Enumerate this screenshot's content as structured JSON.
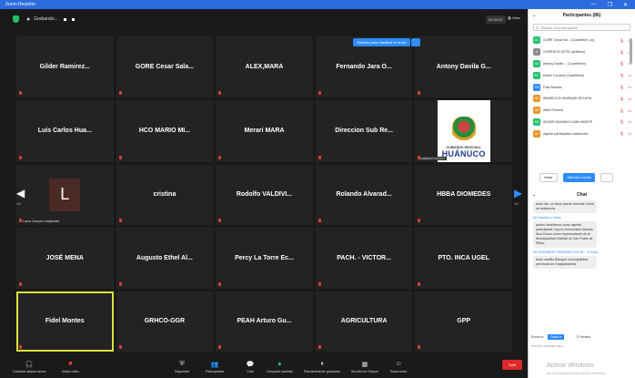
{
  "window": {
    "title": "Zoom Reunión",
    "min": "—",
    "max": "❐",
    "close": "✕"
  },
  "topbar": {
    "status": "Grabando...",
    "time": "02:31:57",
    "view": "Vista"
  },
  "hint": {
    "text": "Solicitar para reactivar el audio",
    "more": "…"
  },
  "tiles": [
    {
      "name": "Gilder Ramirez..."
    },
    {
      "name": "GORE Cesar Sala..."
    },
    {
      "name": "ALEX,MARA"
    },
    {
      "name": "Fernando Jara O..."
    },
    {
      "name": "Antony Davila G..."
    },
    {
      "name": "Luis Carlos Hua..."
    },
    {
      "name": "HCO MARIO MI..."
    },
    {
      "name": "Merari MARA"
    },
    {
      "name": "Direccion Sub Re..."
    },
    {
      "name": "",
      "logo": true
    },
    {
      "name": "",
      "letter": "L",
      "caption": "Laura Campos malpartida"
    },
    {
      "name": "cristina"
    },
    {
      "name": "Rodolfo VALDIVI..."
    },
    {
      "name": "Rolando Alvarad..."
    },
    {
      "name": "HBBA DIOMEDES"
    },
    {
      "name": "JOSÉ MENA"
    },
    {
      "name": "Augusto Ethel Al..."
    },
    {
      "name": "Percy La Torre Ec..."
    },
    {
      "name": "PACH. - VICTOR..."
    },
    {
      "name": "PTO. INCA UGEL"
    },
    {
      "name": "Fidel Montes",
      "active": true
    },
    {
      "name": "GRHCO-GGR"
    },
    {
      "name": "PEAH Arturo Gu..."
    },
    {
      "name": "AGRICULTURA"
    },
    {
      "name": "GPP"
    }
  ],
  "logo": {
    "small": "GOBIERNO REGIONAL",
    "big": "HUÁNUCO",
    "caption": "GOREHCO-SG/EDA"
  },
  "nav": {
    "left_page": "1/4",
    "right_page": "1/4"
  },
  "toolbar": {
    "audio": "Conectar altavoz ahora",
    "video": "Iniciar video",
    "security": "Seguridad",
    "participants": "Participantes",
    "participants_count": "86",
    "chat": "Chat",
    "share": "Compartir pantalla",
    "record": "Pausar/detener grabación",
    "breakout": "Sección en Grupos",
    "reactions": "Reacciones",
    "end": "Salir"
  },
  "panel": {
    "title": "Participantes (86)",
    "search_placeholder": "Buscar un participante",
    "participants": [
      {
        "initials": "GC",
        "color": "#23c16b",
        "name": "GORE Cesar Sa... (Coanfitrión, yo)"
      },
      {
        "initials": "G",
        "color": "#8a8a8a",
        "name": "GOREHCO-SGTD (Anfitrión)"
      },
      {
        "initials": "AD",
        "color": "#23c16b",
        "name": "Antony Davila ... (Coanfitrión)"
      },
      {
        "initials": "EC",
        "color": "#23c16b",
        "name": "Edwin Cordova (Coanfitrión)"
      },
      {
        "initials": "FM",
        "color": "#2d8cff",
        "name": "Fidel Montes"
      },
      {
        "initials": "AD",
        "color": "#e8962a",
        "name": "ABIMELECH DURAND SEGURA"
      },
      {
        "initials": "AR",
        "color": "#e8962a",
        "name": "Adler Romero"
      },
      {
        "initials": "AD",
        "color": "#23c16b",
        "name": "ADNER DAMIAN LUJAN INDEPE"
      },
      {
        "initials": "AP",
        "color": "#e8962a",
        "name": "Agente participativo Ioaricocha"
      }
    ],
    "invite": "Invitar",
    "unmute_all": "Silenciar a todos",
    "more": "…"
  },
  "chat": {
    "title": "Chat",
    "messages": [
      {
        "from": "",
        "text": "buen dia, un favor puede reenviar el link de asistencia"
      },
      {
        "from": "De Nazario a Todos",
        "text": "quiero inscribirme como agente participante, soy el economista Nazario Alva Duran como representante de la Municipalidad Distrital de San Pablo de Pillao."
      },
      {
        "from": "De ROSSMERY HERMINIO ESPIN... a Todos",
        "text": "buen castillo Baluque municipalidad provincial de Huaycabamba"
      }
    ],
    "send_to_label": "Enviar a:",
    "send_to_value": "Todos ▾",
    "files_label": "Archivo",
    "compose_placeholder": "Escribir mensaje aquí..."
  },
  "watermark": {
    "line1": "Activar Windows",
    "line2": "Ve a Configuración para activar Windows."
  }
}
